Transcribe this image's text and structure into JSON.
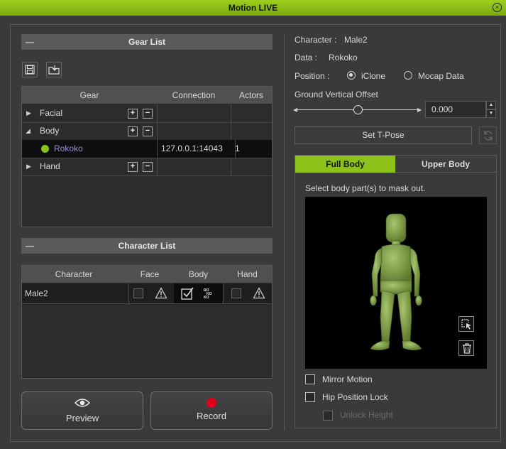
{
  "window": {
    "title": "Motion LIVE"
  },
  "gear_list": {
    "header": "Gear List",
    "columns": [
      "Gear",
      "Connection",
      "Actors"
    ],
    "rows": [
      {
        "name": "Facial",
        "connection": "",
        "actors": ""
      },
      {
        "name": "Body",
        "connection": "",
        "actors": ""
      },
      {
        "name": "Rokoko",
        "connection": "127.0.0.1:14043",
        "actors": "1"
      },
      {
        "name": "Hand",
        "connection": "",
        "actors": ""
      }
    ]
  },
  "character_list": {
    "header": "Character List",
    "columns": [
      "Character",
      "Face",
      "Body",
      "Hand"
    ],
    "rows": [
      {
        "character": "Male2"
      }
    ]
  },
  "buttons": {
    "preview": "Preview",
    "record": "Record"
  },
  "right": {
    "character_label": "Character :",
    "character_value": "Male2",
    "data_label": "Data :",
    "data_value": "Rokoko",
    "position_label": "Position :",
    "position_options": [
      "iClone",
      "Mocap Data"
    ],
    "position_selected": "iClone",
    "offset_label": "Ground Vertical Offset",
    "offset_value": "0.000",
    "offset_slider_fraction": 0.5,
    "tpose_label": "Set T-Pose",
    "tabs": [
      "Full Body",
      "Upper Body"
    ],
    "active_tab": "Full Body",
    "mask_instruction": "Select body part(s) to mask out.",
    "mirror_motion": "Mirror Motion",
    "hip_position_lock": "Hip Position Lock",
    "unlock_height": "Unlock Height"
  },
  "colors": {
    "accent": "#8cc21a",
    "record": "#e0001a",
    "rokoko_text": "#9b8ce0"
  }
}
